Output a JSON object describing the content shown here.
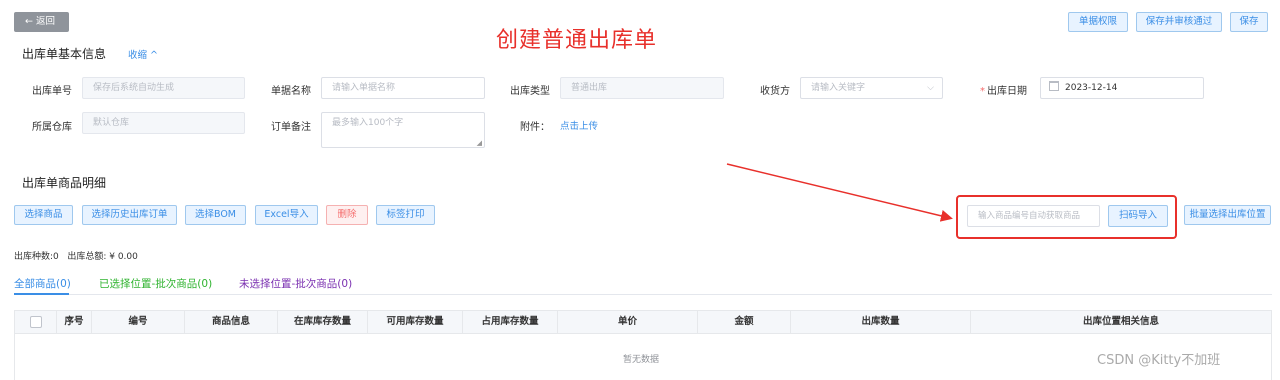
{
  "header": {
    "back_label": "← 返回",
    "page_heading": "创建普通出库单",
    "buttons": {
      "permissions": "单据权限",
      "save_audit": "保存并审核通过",
      "save": "保存"
    }
  },
  "basic_info": {
    "title": "出库单基本信息",
    "collapse_label": "收缩 ^",
    "fields": {
      "order_no": {
        "label": "出库单号",
        "placeholder": "保存后系统自动生成"
      },
      "doc_name": {
        "label": "单据名称",
        "placeholder": "请输入单据名称"
      },
      "out_type": {
        "label": "出库类型",
        "value": "普通出库"
      },
      "receiver": {
        "label": "收货方",
        "placeholder": "请输入关键字"
      },
      "out_date": {
        "label": "出库日期",
        "required_mark": "*",
        "value": "2023-12-14"
      },
      "warehouse": {
        "label": "所属仓库",
        "placeholder": "默认仓库"
      },
      "remark": {
        "label": "订单备注",
        "placeholder": "最多输入100个字"
      },
      "attachment": {
        "label": "附件：",
        "upload_label": "点击上传"
      }
    }
  },
  "detail": {
    "title": "出库单商品明细",
    "toolbar": {
      "select_goods": "选择商品",
      "select_history": "选择历史出库订单",
      "select_bom": "选择BOM",
      "excel_import": "Excel导入",
      "delete": "删除",
      "label_print": "标签打印"
    },
    "scan": {
      "placeholder": "输入商品编号自动获取商品",
      "button": "扫码导入"
    },
    "batch_location": "批量选择出库位置",
    "summary": "出库种数:0   出库总额: ¥ 0.00",
    "tabs": [
      {
        "label": "全部商品(0)",
        "color": "#3a8ee6"
      },
      {
        "label": "已选择位置-批次商品(0)",
        "color": "#2fb32f"
      },
      {
        "label": "未选择位置-批次商品(0)",
        "color": "#7a2fb0"
      }
    ],
    "table": {
      "columns": [
        "序号",
        "编号",
        "商品信息",
        "在库库存数量",
        "可用库存数量",
        "占用库存数量",
        "单价",
        "金额",
        "出库数量",
        "出库位置相关信息"
      ],
      "empty_text": "暂无数据"
    }
  },
  "watermark": "CSDN @Kitty不加班",
  "colors": {
    "accent": "#3a8ee6",
    "annotation_red": "#e8302b",
    "danger": "#f56c6c"
  }
}
